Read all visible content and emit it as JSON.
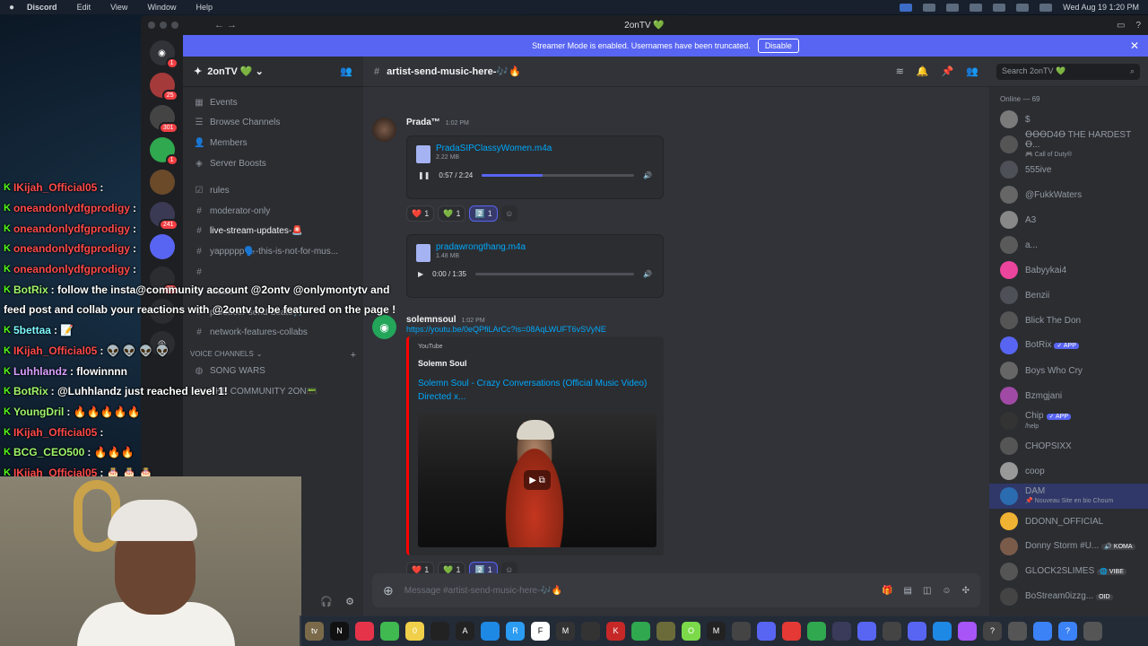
{
  "menubar": {
    "app": "Discord",
    "items": [
      "Edit",
      "View",
      "Window",
      "Help"
    ],
    "clock": "Wed Aug 19  1:20 PM"
  },
  "window": {
    "title": "2onTV 💚"
  },
  "banner": {
    "text": "Streamer Mode is enabled. Usernames have been truncated.",
    "button": "Disable"
  },
  "servers": [
    {
      "badge": "1"
    },
    {
      "badge": "25"
    },
    {
      "badge": "301"
    },
    {
      "badge": "1"
    },
    {
      "badge": "241"
    },
    {
      "badge": "39"
    }
  ],
  "guild": {
    "name": "2onTV 💚"
  },
  "channels": {
    "top": [
      "Events",
      "Browse Channels",
      "Members",
      "Server Boosts"
    ],
    "text": [
      {
        "name": "rules",
        "unread": false
      },
      {
        "name": "moderator-only",
        "unread": false
      },
      {
        "name": "live-stream-updates-🚨",
        "unread": true
      },
      {
        "name": "yappppp🗣️-this-is-not-for-mus...",
        "unread": false
      },
      {
        "name": "",
        "unread": false
      },
      {
        "name": "music",
        "unread": false
      },
      {
        "name": "producer-send-beats🎵",
        "unread": false
      },
      {
        "name": "network-features-collabs",
        "unread": false
      }
    ],
    "voice_category": "Voice Channels",
    "voice": [
      "SONG WARS",
      "THE COMMUNITY 2ON📟"
    ]
  },
  "channel_header": {
    "name": "artist-send-music-here-🎶🔥"
  },
  "messages": {
    "prada": {
      "author": "Prada™",
      "time": "1:02 PM",
      "file1": {
        "name": "PradaSIPClassyWomen.m4a",
        "size": "2.22 MB",
        "time": "0:57 / 2:24",
        "progress": 0.4
      },
      "file2": {
        "name": "pradawrongthang.m4a",
        "size": "1.48 MB",
        "time": "0:00 / 1:35",
        "progress": 0.0
      },
      "reactions": [
        {
          "emoji": "❤️",
          "count": "1"
        },
        {
          "emoji": "💚",
          "count": "1"
        },
        {
          "emoji": "2️⃣",
          "count": "1"
        }
      ]
    },
    "solemn": {
      "author": "solemnsoul",
      "time": "1:02 PM",
      "link": "https://youtu.be/0eQPfiLArCc?is=08AqLWUFT6vSVyNE",
      "embed_provider": "YouTube",
      "embed_author": "Solemn Soul",
      "embed_title": "Solemn Soul - Crazy Conversations (Official Music Video) Directed x...",
      "reactions": [
        {
          "emoji": "❤️",
          "count": "1"
        },
        {
          "emoji": "💚",
          "count": "1"
        },
        {
          "emoji": "2️⃣",
          "count": "1"
        }
      ]
    }
  },
  "composer": {
    "placeholder": "Message #artist-send-music-here-🎶🔥"
  },
  "members": {
    "search_placeholder": "Search 2onTV 💚",
    "group": "Online — 69",
    "list": [
      {
        "name": "$",
        "sub": "",
        "tag": ""
      },
      {
        "name": "ꝊꝊꝊD4Ꝋ THE HARDEST Ꝋ...",
        "sub": "🎮 Call of Duty®",
        "tag": ""
      },
      {
        "name": "555ive",
        "sub": "",
        "tag": ""
      },
      {
        "name": "@FukkWaters",
        "sub": "",
        "tag": ""
      },
      {
        "name": "A3",
        "sub": "",
        "tag": ""
      },
      {
        "name": "a...",
        "sub": "",
        "tag": ""
      },
      {
        "name": "Babyykai4",
        "sub": "",
        "tag": ""
      },
      {
        "name": "Benzii",
        "sub": "",
        "tag": ""
      },
      {
        "name": "Blick The Don",
        "sub": "",
        "tag": ""
      },
      {
        "name": "BotRix",
        "sub": "",
        "tag": "✓ APP"
      },
      {
        "name": "Boys Who Cry",
        "sub": "",
        "tag": ""
      },
      {
        "name": "Bzmgjani",
        "sub": "",
        "tag": ""
      },
      {
        "name": "Chip",
        "sub": "/help",
        "tag": "✓ APP"
      },
      {
        "name": "CHOPSIXX",
        "sub": "",
        "tag": ""
      },
      {
        "name": "coop",
        "sub": "",
        "tag": ""
      },
      {
        "name": "DAM",
        "sub": "📌 Nouveau Site en bio Choum",
        "tag": ""
      },
      {
        "name": "DDONN_OFFICIAL",
        "sub": "",
        "tag": ""
      },
      {
        "name": "Donny Storm #U...",
        "sub": "",
        "tag2": "🔊 KOMA"
      },
      {
        "name": "GLOCK2SLIMES",
        "sub": "",
        "tag2": "🌐 VIBE"
      },
      {
        "name": "BoStream0izzg...",
        "sub": "",
        "tag2": "OID"
      }
    ]
  },
  "chat_overlay": [
    {
      "user": "IKijah_Official05",
      "text": ":"
    },
    {
      "user": "oneandonlydfgprodigy",
      "text": ":"
    },
    {
      "user": "oneandonlydfgprodigy",
      "text": ":"
    },
    {
      "user": "oneandonlydfgprodigy",
      "text": ":"
    },
    {
      "user": "oneandonlydfgprodigy",
      "text": ":"
    },
    {
      "user": "BotRix",
      "text": ": follow the insta@community account @2ontv @onlymontytv and"
    },
    {
      "user": "",
      "text": "feed post and collab your reactions with @2ontv to be featured on the page !"
    },
    {
      "user": "5bettaa",
      "text": ": 📝"
    },
    {
      "user": "IKijah_Official05",
      "text": ": 👽 👽 👽 👽"
    },
    {
      "user": "Luhhlandz",
      "text": ": flowinnnn"
    },
    {
      "user": "BotRix",
      "text": ": @Luhhlandz just reached level 1!"
    },
    {
      "user": "YoungDril",
      "text": ": 🔥🔥🔥🔥🔥"
    },
    {
      "user": "IKijah_Official05",
      "text": ":"
    },
    {
      "user": "BCG_CEO500",
      "text": ": 🔥🔥🔥"
    },
    {
      "user": "IKijah_Official05",
      "text": ": 🎂 🎂 🎂"
    }
  ],
  "dock": [
    "tv",
    "N",
    "",
    "",
    "0",
    "",
    "A",
    "",
    "R",
    "F",
    "M",
    "",
    "K",
    "",
    "",
    "O",
    "M",
    "",
    "",
    "",
    "",
    "",
    "",
    "",
    "",
    "",
    "",
    "?",
    "",
    "",
    "?",
    ""
  ]
}
